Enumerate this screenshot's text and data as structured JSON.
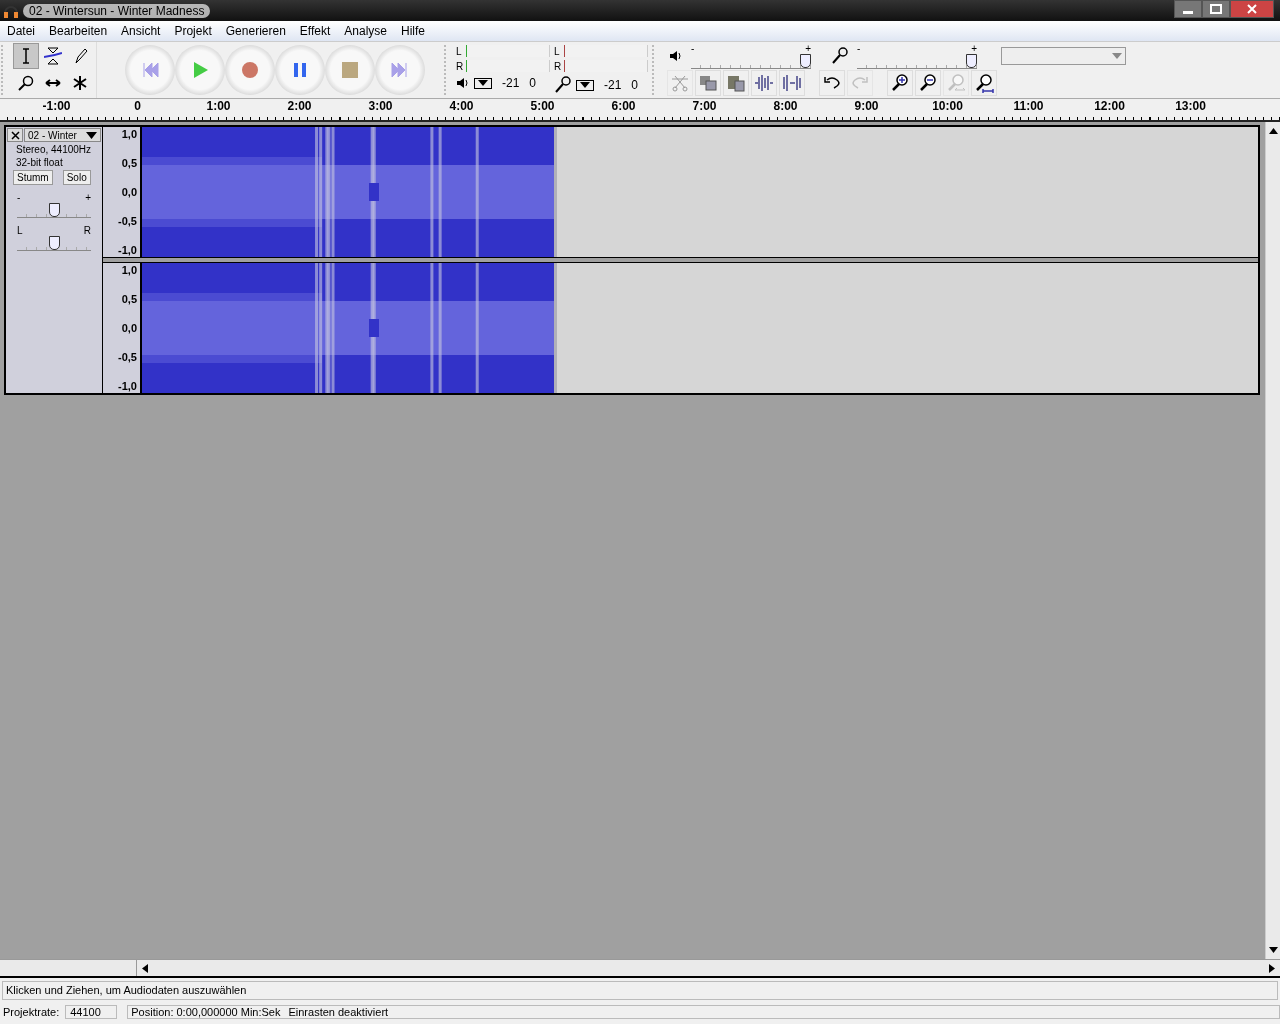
{
  "window": {
    "title": "02 - Wintersun - Winter Madness"
  },
  "menu": [
    "Datei",
    "Bearbeiten",
    "Ansicht",
    "Projekt",
    "Generieren",
    "Effekt",
    "Analyse",
    "Hilfe"
  ],
  "tools": [
    {
      "kind": "select",
      "selected": true
    },
    {
      "kind": "envelope",
      "selected": false
    },
    {
      "kind": "draw",
      "selected": false
    },
    {
      "kind": "zoom",
      "selected": false
    },
    {
      "kind": "timeshift",
      "selected": false
    },
    {
      "kind": "multi",
      "selected": false
    }
  ],
  "transport": [
    {
      "kind": "start"
    },
    {
      "kind": "play"
    },
    {
      "kind": "record"
    },
    {
      "kind": "pause"
    },
    {
      "kind": "stop"
    },
    {
      "kind": "end"
    }
  ],
  "meters": [
    {
      "kind": "playback",
      "channels": [
        "L",
        "R"
      ],
      "scale": [
        "-21",
        "0"
      ]
    },
    {
      "kind": "record",
      "channels": [
        "L",
        "R"
      ],
      "scale": [
        "-21",
        "0"
      ]
    }
  ],
  "mixer": {
    "playback_volume": {
      "level": 1.0,
      "minus": "-",
      "plus": "+"
    },
    "record_volume": {
      "level": 1.0,
      "minus": "-",
      "plus": "+"
    }
  },
  "edit_tools": [
    {
      "kind": "cut",
      "disabled": true
    },
    {
      "kind": "copy",
      "disabled": false
    },
    {
      "kind": "paste",
      "disabled": false
    },
    {
      "kind": "trim",
      "disabled": false
    },
    {
      "kind": "silence",
      "disabled": false
    },
    {
      "kind": "undo",
      "disabled": false
    },
    {
      "kind": "redo",
      "disabled": true
    },
    {
      "kind": "zoom-in",
      "disabled": false
    },
    {
      "kind": "zoom-out",
      "disabled": false
    },
    {
      "kind": "fit-selection",
      "disabled": true
    },
    {
      "kind": "fit-project",
      "disabled": false
    }
  ],
  "ruler": [
    "-1:00",
    "0",
    "1:00",
    "2:00",
    "3:00",
    "4:00",
    "5:00",
    "6:00",
    "7:00",
    "8:00",
    "9:00",
    "10:00",
    "11:00",
    "12:00",
    "13:00"
  ],
  "track": {
    "name": "02 - Winter",
    "info": [
      "Stereo, 44100Hz",
      "32-bit float"
    ],
    "buttons": [
      {
        "label": "Stumm",
        "selected": false
      },
      {
        "label": "Solo",
        "selected": false
      }
    ],
    "gain": {
      "level": 0.5,
      "min": "-",
      "max": "+"
    },
    "pan": {
      "level": 0.5,
      "min": "L",
      "max": "R"
    },
    "channels": [
      {
        "axis": [
          "1,0",
          "0,5",
          "0,0",
          "-0,5",
          "-1,0"
        ]
      },
      {
        "axis": [
          "1,0",
          "0,5",
          "0,0",
          "-0,5",
          "-1,0"
        ]
      }
    ]
  },
  "status_bar": {
    "message": "Klicken und Ziehen, um Audiodaten auszuwählen",
    "rate_label": "Projektrate:",
    "rate": "44100",
    "position": "Position: 0:00,000000 Min:Sek",
    "snap": "Einrasten deaktiviert"
  }
}
